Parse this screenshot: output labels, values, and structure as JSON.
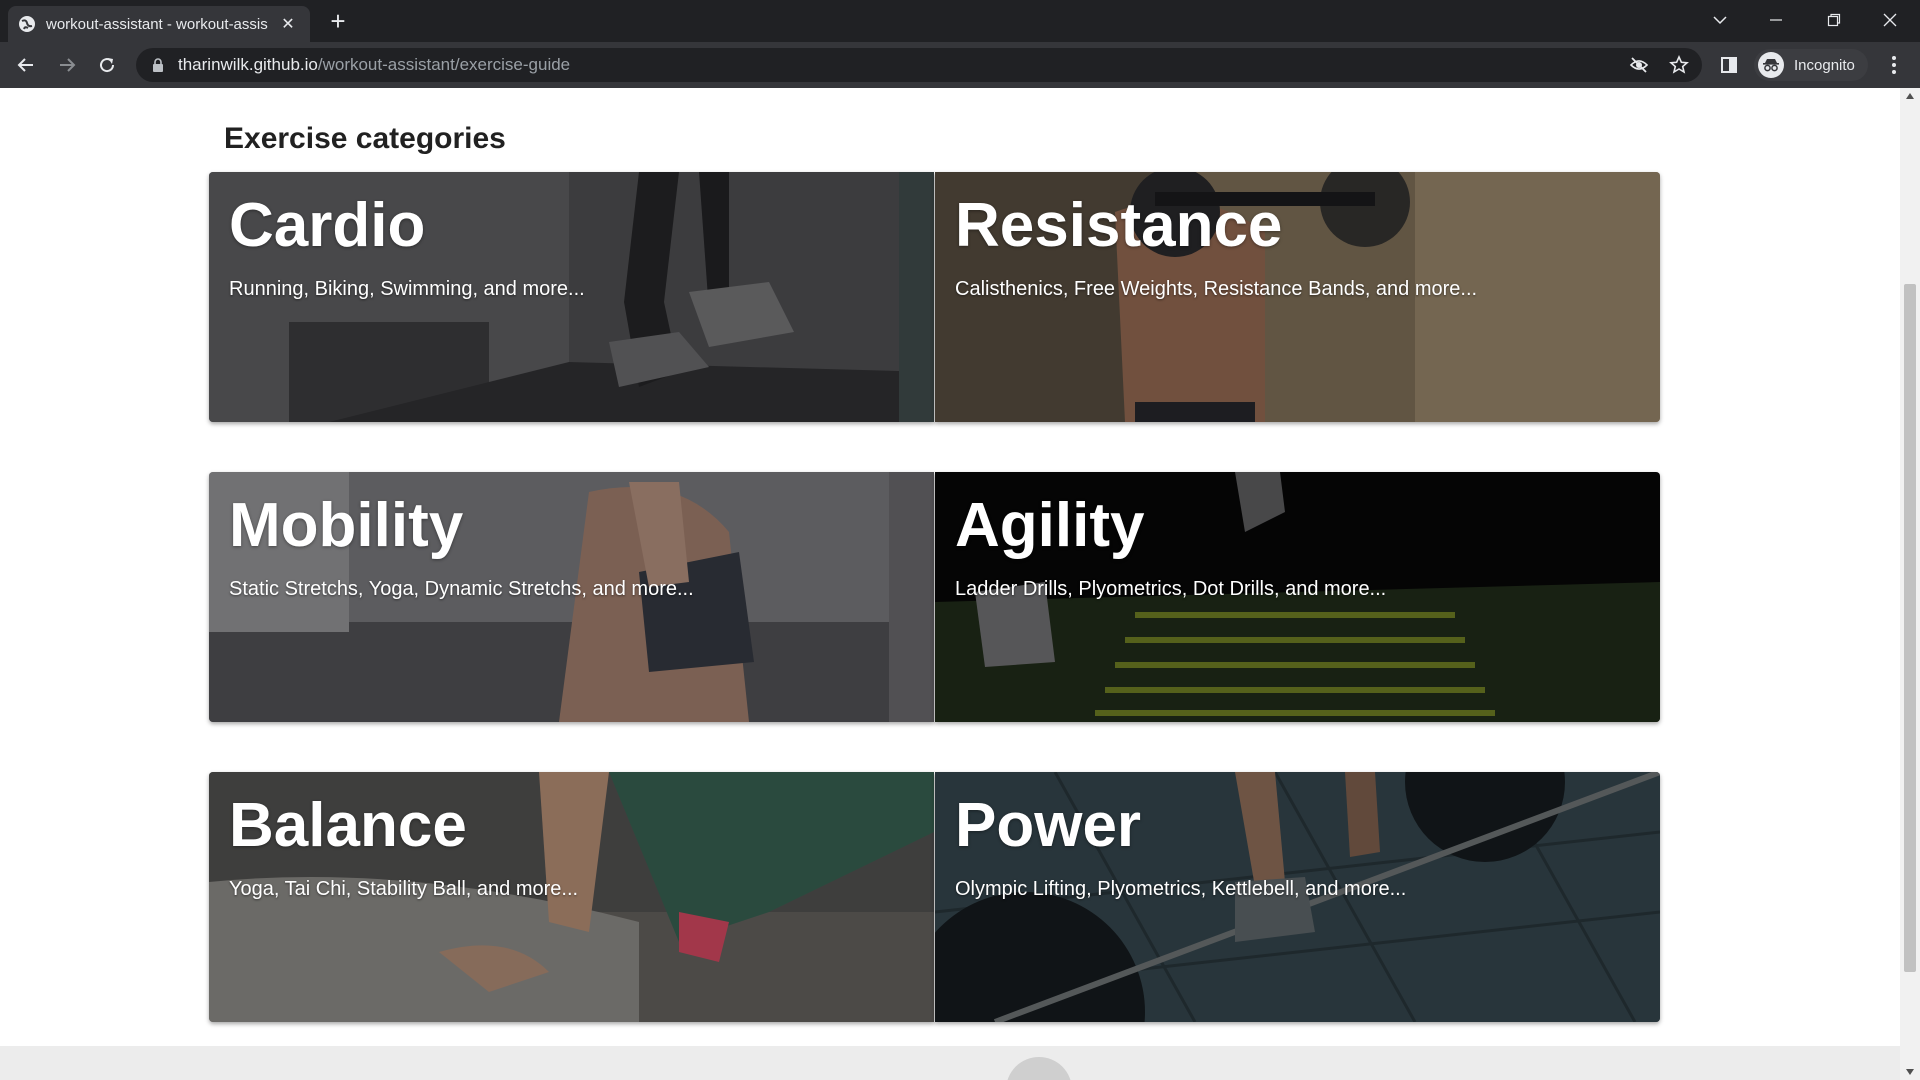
{
  "browser": {
    "tab_title": "workout-assistant - workout-assistant",
    "url_host": "tharinwilk.github.io",
    "url_path": "/workout-assistant/exercise-guide",
    "profile_label": "Incognito"
  },
  "page": {
    "section_title": "Exercise categories",
    "categories": [
      {
        "title": "Cardio",
        "description": "Running, Biking, Swimming, and more..."
      },
      {
        "title": "Resistance",
        "description": "Calisthenics, Free Weights, Resistance Bands, and more..."
      },
      {
        "title": "Mobility",
        "description": "Static Stretchs, Yoga, Dynamic Stretchs, and more..."
      },
      {
        "title": "Agility",
        "description": "Ladder Drills, Plyometrics, Dot Drills, and more..."
      },
      {
        "title": "Balance",
        "description": "Yoga, Tai Chi, Stability Ball, and more..."
      },
      {
        "title": "Power",
        "description": "Olympic Lifting, Plyometrics, Kettlebell, and more..."
      }
    ]
  },
  "colors": {
    "chrome_dark": "#202124",
    "chrome_toolbar": "#35363a",
    "card_text": "#ffffff",
    "title_text": "#212121"
  }
}
